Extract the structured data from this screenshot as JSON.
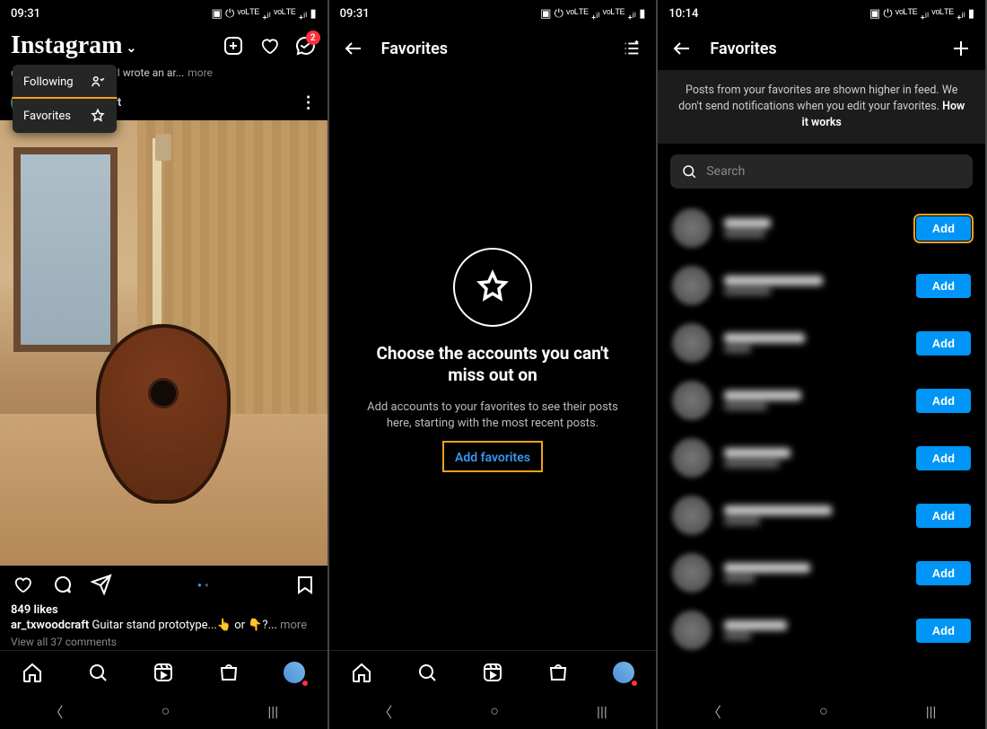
{
  "screen1": {
    "status": {
      "time": "09:31",
      "icons": "▣ ⏻ ᵛᵒᴸᵀᴱ ₊ᵢₗ ᵛᵒᴸᵀᴱ ₊ᵢₗ ▮"
    },
    "logo": "Instagram",
    "badge_count": "2",
    "dropdown": {
      "following": "Following",
      "favorites": "Favorites"
    },
    "top_caption_snip": "concealment issue🎉 I wrote an ar...",
    "top_caption_more": "more",
    "post": {
      "user": "ar_txwoodcraft",
      "likes": "849 likes",
      "caption_user": "ar_txwoodcraft",
      "caption_text": " Guitar stand prototype...👆 or 👇?...",
      "caption_more": " more",
      "view_comments": "View all 37 comments"
    }
  },
  "screen2": {
    "status": {
      "time": "09:31",
      "icons": "▣ ⏻ ᵛᵒᴸᵀᴱ ₊ᵢₗ ᵛᵒᴸᵀᴱ ₊ᵢₗ ▮"
    },
    "title": "Favorites",
    "empty": {
      "heading": "Choose the accounts you can't miss out on",
      "body": "Add accounts to your favorites to see their posts here, starting with the most recent posts.",
      "cta": "Add favorites"
    }
  },
  "screen3": {
    "status": {
      "time": "10:14",
      "icons": "▣ ⏻ ᵛᵒᴸᵀᴱ ₊ᵢₗ ᵛᵒᴸᵀᴱ ₊ᵢₗ ▮"
    },
    "title": "Favorites",
    "banner": "Posts from your favorites are shown higher in feed. We don't send notifications when you edit your favorites. ",
    "banner_link": "How it works",
    "search_placeholder": "Search",
    "add_label": "Add",
    "accounts": [
      {
        "w1": 52,
        "w2": 46
      },
      {
        "w1": 110,
        "w2": 52
      },
      {
        "w1": 90,
        "w2": 30
      },
      {
        "w1": 86,
        "w2": 48
      },
      {
        "w1": 74,
        "w2": 62
      },
      {
        "w1": 120,
        "w2": 40
      },
      {
        "w1": 96,
        "w2": 34
      },
      {
        "w1": 70,
        "w2": 30
      }
    ]
  }
}
